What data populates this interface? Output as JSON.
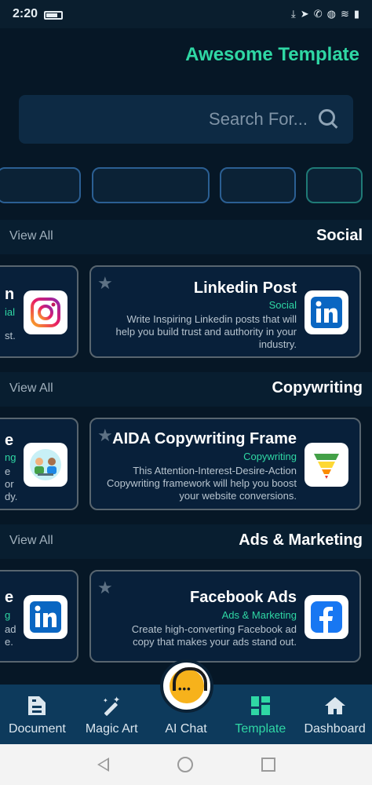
{
  "status_bar": {
    "time": "2:20"
  },
  "header": {
    "title": "Awesome Template"
  },
  "search": {
    "placeholder": "Search For..."
  },
  "sections": [
    {
      "title": "Social",
      "view_all": "View All",
      "partial_card": {
        "name_fragment": "n",
        "category_fragment": "ial",
        "desc_fragment": "st."
      },
      "card": {
        "name": "Linkedin Post",
        "category": "Social",
        "description": "Write Inspiring Linkedin posts that will help you build trust and authority in your industry.",
        "logo": "linkedin-logo"
      }
    },
    {
      "title": "Copywriting",
      "view_all": "View All",
      "partial_card": {
        "name_fragment": "e",
        "category_fragment": "ng",
        "desc_fragment_1": "e",
        "desc_fragment_2": "or",
        "desc_fragment_3": "dy."
      },
      "card": {
        "name": "AIDA Copywriting Frame",
        "category": "Copywriting",
        "description": "This Attention-Interest-Desire-Action Copywriting framework will help you boost your website conversions.",
        "logo": "funnel-logo"
      }
    },
    {
      "title": "Ads & Marketing",
      "view_all": "View All",
      "partial_card": {
        "name_fragment": "e",
        "category_fragment": "g",
        "desc_fragment_1": "ad",
        "desc_fragment_2": "e."
      },
      "card": {
        "name": "Facebook Ads",
        "category": "Ads & Marketing",
        "description": "Create high-converting Facebook ad copy that makes your ads stand out.",
        "logo": "facebook-logo"
      }
    }
  ],
  "bottom_nav": {
    "items": [
      {
        "label": "Document",
        "icon": "document-icon"
      },
      {
        "label": "Magic Art",
        "icon": "magic-wand-icon"
      },
      {
        "label": "AI Chat",
        "icon": "headset-chat-icon"
      },
      {
        "label": "Template",
        "icon": "grid-icon",
        "active": true
      },
      {
        "label": "Dashboard",
        "icon": "home-icon"
      }
    ]
  },
  "colors": {
    "accent": "#2fd7a4",
    "background": "#061726",
    "nav": "#0d3a5c"
  }
}
